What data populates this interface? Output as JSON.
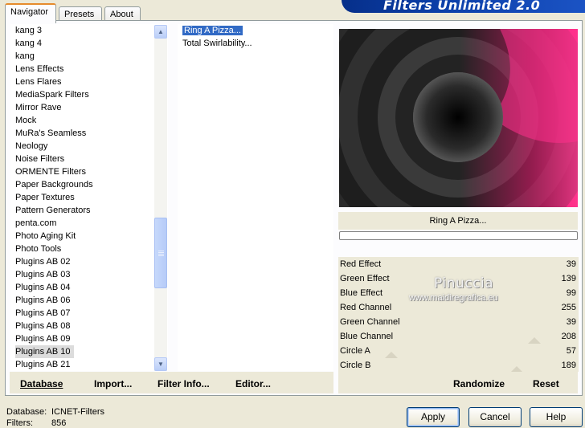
{
  "tabs": [
    "Navigator",
    "Presets",
    "About"
  ],
  "banner_title": "Filters Unlimited 2.0",
  "categories": [
    "kang 3",
    "kang 4",
    "kang",
    "Lens Effects",
    "Lens Flares",
    "MediaSpark Filters",
    "Mirror Rave",
    "Mock",
    "MuRa's Seamless",
    "Neology",
    "Noise Filters",
    "ORMENTE Filters",
    "Paper Backgrounds",
    "Paper Textures",
    "Pattern Generators",
    "penta.com",
    "Photo Aging Kit",
    "Photo Tools",
    "Plugins AB 02",
    "Plugins AB 03",
    "Plugins AB 04",
    "Plugins AB 06",
    "Plugins AB 07",
    "Plugins AB 08",
    "Plugins AB 09",
    "Plugins AB 10",
    "Plugins AB 21"
  ],
  "selected_category": "Plugins AB 10",
  "filters": [
    "Ring A Pizza...",
    "Total Swirlability..."
  ],
  "selected_filter": "Ring A Pizza...",
  "preview_filter_name": "Ring A Pizza...",
  "params": [
    {
      "label": "Red Effect",
      "value": "39"
    },
    {
      "label": "Green Effect",
      "value": "139"
    },
    {
      "label": "Blue Effect",
      "value": "99"
    },
    {
      "label": "Red Channel",
      "value": "255"
    },
    {
      "label": "Green Channel",
      "value": "39"
    },
    {
      "label": "Blue Channel",
      "value": "208"
    },
    {
      "label": "Circle A",
      "value": "57"
    },
    {
      "label": "Circle B",
      "value": "189"
    }
  ],
  "watermark": {
    "name": "Pinuccia",
    "url": "www.maidiregrafica.eu"
  },
  "buttons": {
    "database": "Database",
    "import": "Import...",
    "filter_info": "Filter Info...",
    "editor": "Editor...",
    "randomize": "Randomize",
    "reset": "Reset",
    "apply": "Apply",
    "cancel": "Cancel",
    "help": "Help"
  },
  "footer": {
    "database_label": "Database:",
    "database_value": "ICNET-Filters",
    "filters_label": "Filters:",
    "filters_value": "856"
  },
  "icons": {
    "scroll_up": "scroll-up-arrow-icon",
    "scroll_down": "scroll-down-arrow-icon"
  },
  "colors": {
    "preview_accent": "#ff1a7a",
    "selection": "#316ac5",
    "tab_highlight": "#e68b2c"
  }
}
